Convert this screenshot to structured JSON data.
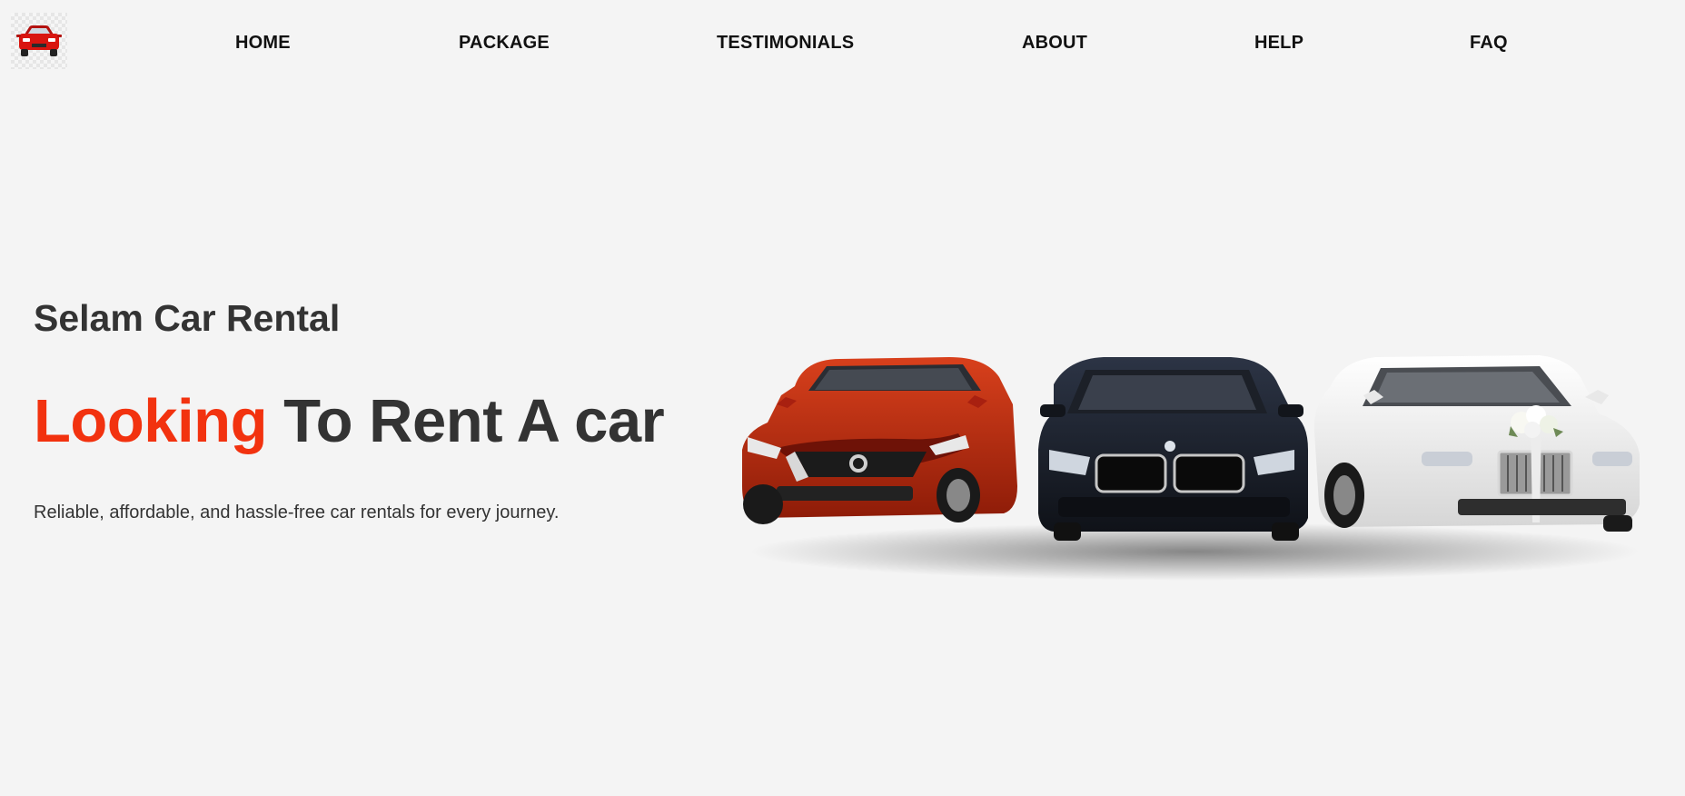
{
  "nav": {
    "logo_icon": "car-icon",
    "items": [
      {
        "label": "HOME"
      },
      {
        "label": "PACKAGE"
      },
      {
        "label": "TESTIMONIALS"
      },
      {
        "label": "ABOUT"
      },
      {
        "label": "HELP"
      },
      {
        "label": "FAQ"
      }
    ]
  },
  "hero": {
    "brand": "Selam Car Rental",
    "headline_accent": "Looking",
    "headline_rest": " To Rent A car",
    "tagline": "Reliable, affordable, and hassle-free car rentals for every journey.",
    "image_icon": "cars-image"
  },
  "colors": {
    "accent": "#f2320f",
    "text": "#333333",
    "background": "#f4f4f4",
    "car_red": "#c0280e",
    "car_dark": "#1a1f2b",
    "car_white": "#f0f0f0"
  }
}
